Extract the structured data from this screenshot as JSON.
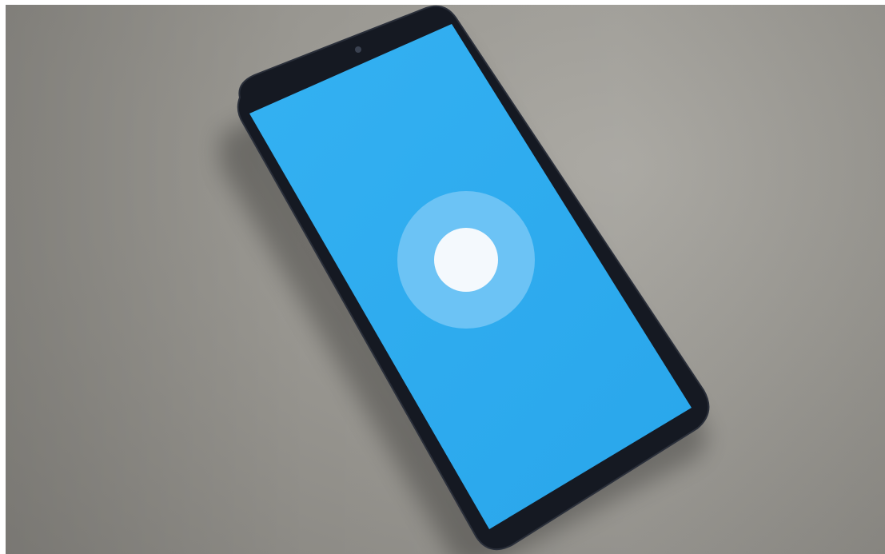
{
  "photo": {
    "subject": "smartphone",
    "colors": {
      "background": "#9d9b95",
      "phone_body": "#141820",
      "screen": "#2eabee",
      "halo": "#6cc3f5",
      "dot": "#f4f9fd"
    },
    "icons": [
      "front-camera-icon"
    ]
  }
}
